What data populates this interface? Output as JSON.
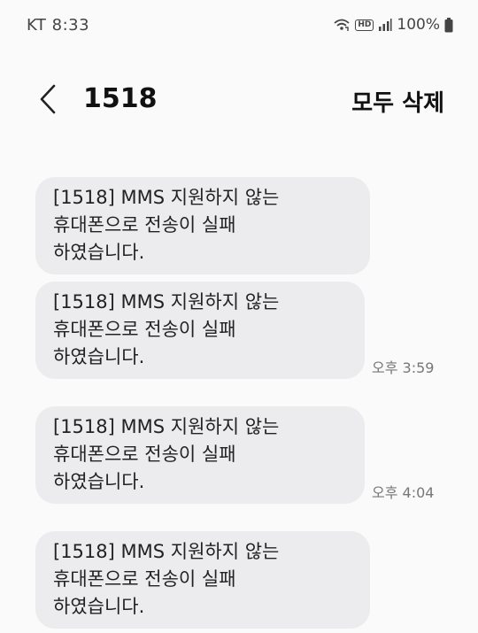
{
  "status_bar": {
    "carrier_time": "KT 8:33",
    "hd_label": "HD",
    "battery": "100%"
  },
  "header": {
    "title": "1518",
    "delete_all_label": "모두 삭제"
  },
  "messages": [
    {
      "text": "[1518] MMS 지원하지 않는\n휴대폰으로 전송이 실패\n하였습니다.",
      "time": ""
    },
    {
      "text": "[1518] MMS 지원하지 않는\n휴대폰으로 전송이 실패\n하였습니다.",
      "time": "오후 3:59"
    },
    {
      "text": "[1518] MMS 지원하지 않는\n휴대폰으로 전송이 실패\n하였습니다.",
      "time": "오후 4:04"
    },
    {
      "text": "[1518] MMS 지원하지 않는\n휴대폰으로 전송이 실패\n하였습니다.",
      "time": ""
    }
  ],
  "icons": {
    "back": "chevron-left-icon",
    "wifi": "wifi-call-icon",
    "signal": "signal-bars-icon",
    "battery": "battery-icon"
  }
}
